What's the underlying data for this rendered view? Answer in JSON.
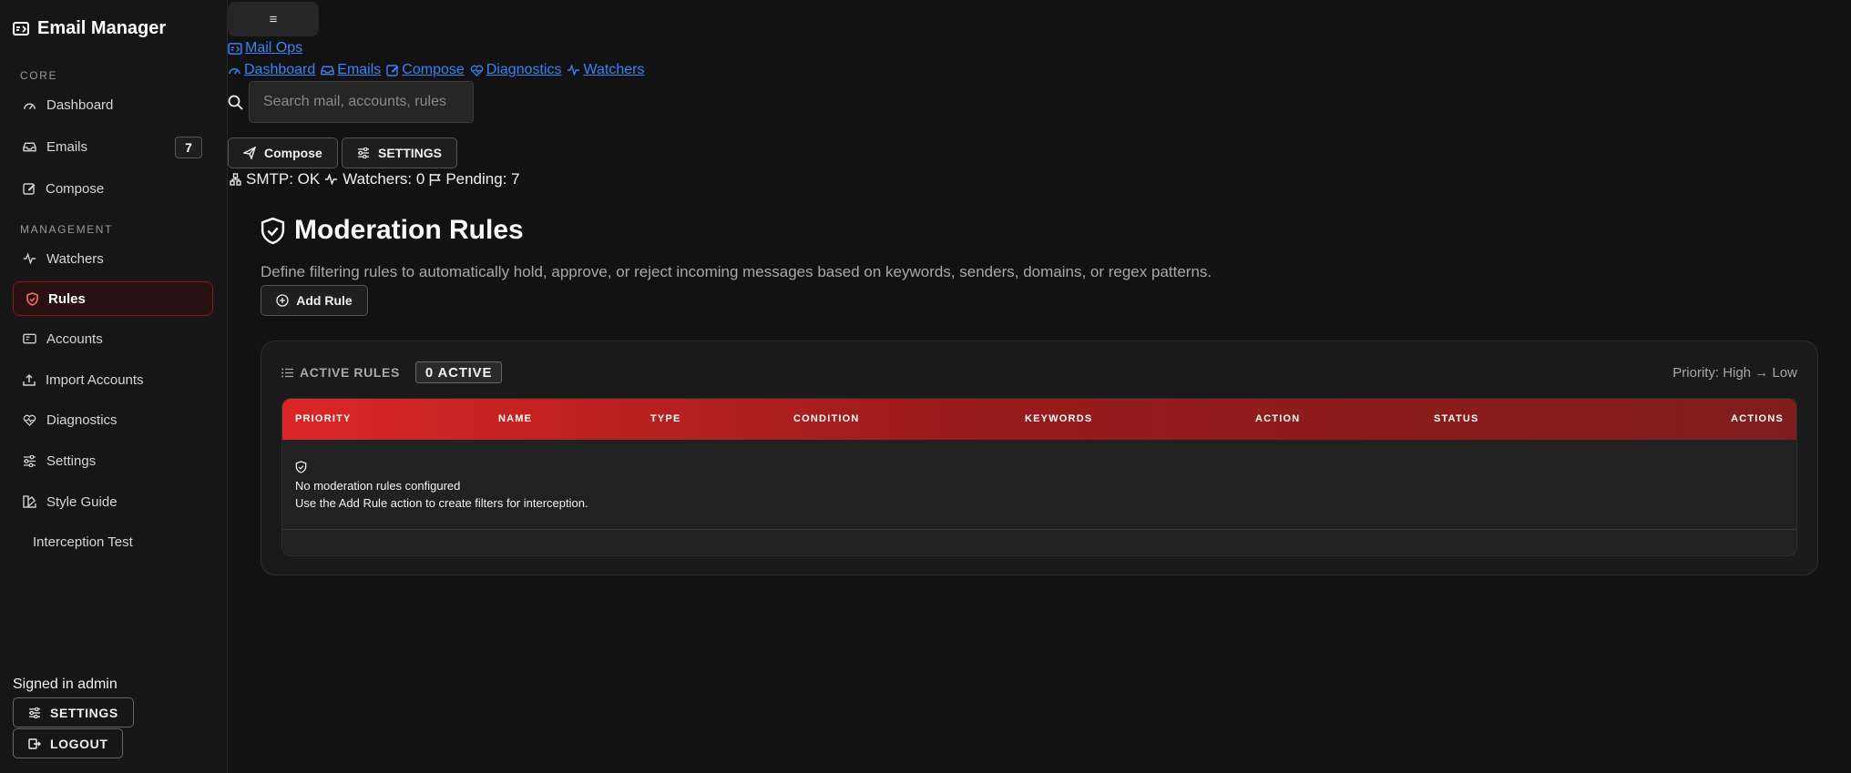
{
  "app": {
    "title": "Email Manager"
  },
  "sidebar": {
    "sections": [
      {
        "label": "CORE"
      },
      {
        "label": "MANAGEMENT"
      }
    ],
    "core_items": [
      {
        "label": "Dashboard",
        "icon": "gauge-icon"
      },
      {
        "label": "Emails",
        "icon": "inbox-icon",
        "badge": "7"
      },
      {
        "label": "Compose",
        "icon": "pencil-square-icon"
      }
    ],
    "management_items": [
      {
        "label": "Watchers",
        "icon": "activity-icon"
      },
      {
        "label": "Rules",
        "icon": "shield-icon",
        "active": true
      },
      {
        "label": "Accounts",
        "icon": "mailbox-icon"
      },
      {
        "label": "Import Accounts",
        "icon": "upload-icon"
      },
      {
        "label": "Diagnostics",
        "icon": "heart-pulse-icon"
      },
      {
        "label": "Settings",
        "icon": "sliders-icon"
      },
      {
        "label": "Style Guide",
        "icon": "palette-icon"
      },
      {
        "label": "Interception Test",
        "icon": ""
      }
    ],
    "signed_in": "Signed in admin",
    "settings_label": "SETTINGS",
    "logout_label": "LOGOUT"
  },
  "topbar": {
    "menu_glyph": "≡",
    "mail_ops_label": "Mail Ops",
    "quick_links": [
      {
        "label": "Dashboard",
        "icon": "gauge-icon"
      },
      {
        "label": "Emails",
        "icon": "inbox-icon"
      },
      {
        "label": "Compose",
        "icon": "pencil-square-icon"
      },
      {
        "label": "Diagnostics",
        "icon": "heart-pulse-icon"
      },
      {
        "label": "Watchers",
        "icon": "activity-icon"
      }
    ],
    "search_placeholder": "Search mail, accounts, rules",
    "compose_label": "Compose",
    "settings_label": "SETTINGS",
    "status": {
      "smtp": "SMTP: OK",
      "watchers": "Watchers: 0",
      "pending": "Pending: 7"
    }
  },
  "main": {
    "title": "Moderation Rules",
    "description": "Define filtering rules to automatically hold, approve, or reject incoming messages based on keywords, senders, domains, or regex patterns.",
    "add_rule_label": "Add Rule",
    "card": {
      "heading": "ACTIVE RULES",
      "count_badge": "0 ACTIVE",
      "priority_note": "Priority: High → Low",
      "columns": [
        "PRIORITY",
        "NAME",
        "TYPE",
        "CONDITION",
        "KEYWORDS",
        "ACTION",
        "STATUS",
        "ACTIONS"
      ],
      "empty_title": "No moderation rules configured",
      "empty_hint": "Use the Add Rule action to create filters for interception."
    }
  },
  "colors": {
    "accent": "#dc2626",
    "link": "#3b82f6",
    "background": "#121212",
    "sidebar": "#161616"
  }
}
